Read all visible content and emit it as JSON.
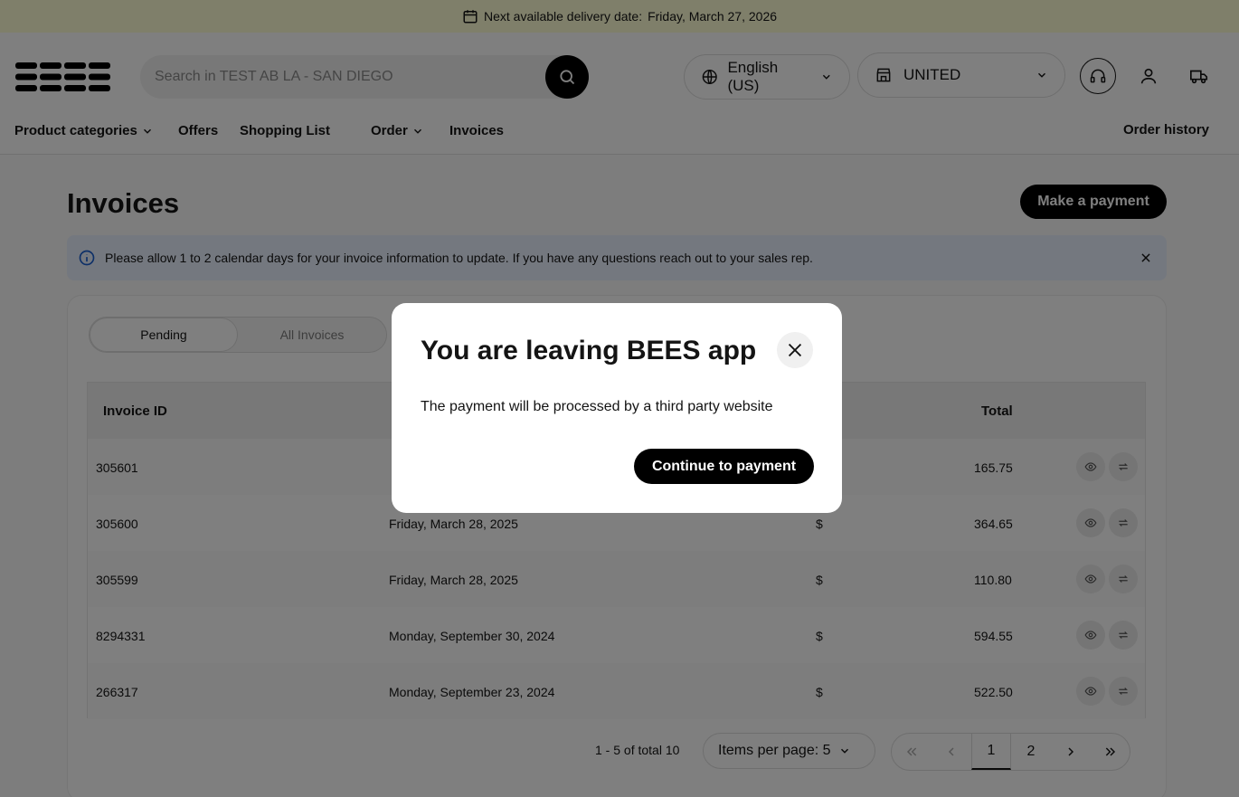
{
  "banner": {
    "prefix": "Next available delivery date:",
    "date": "Friday, March 27, 2026"
  },
  "header": {
    "search_placeholder": "Search in TEST AB LA - SAN DIEGO",
    "language": "English (US)",
    "store": "UNITED"
  },
  "nav": {
    "product_categories": "Product categories",
    "offers": "Offers",
    "shopping_list": "Shopping List",
    "order": "Order",
    "invoices": "Invoices",
    "order_history": "Order history"
  },
  "page": {
    "title": "Invoices",
    "make_payment": "Make a payment",
    "alert": "Please allow 1 to 2 calendar days for your invoice information to update. If you have any questions reach out to your sales rep."
  },
  "tabs": {
    "pending": "Pending",
    "all": "All Invoices"
  },
  "table": {
    "headers": {
      "invoice_id": "Invoice ID",
      "total": "Total"
    },
    "rows": [
      {
        "id": "305601",
        "date": "",
        "currency": "",
        "total": "165.75"
      },
      {
        "id": "305600",
        "date": "Friday, March 28, 2025",
        "currency": "$",
        "total": "364.65"
      },
      {
        "id": "305599",
        "date": "Friday, March 28, 2025",
        "currency": "$",
        "total": "110.80"
      },
      {
        "id": "8294331",
        "date": "Monday, September 30, 2024",
        "currency": "$",
        "total": "594.55"
      },
      {
        "id": "266317",
        "date": "Monday, September 23, 2024",
        "currency": "$",
        "total": "522.50"
      }
    ]
  },
  "pagination": {
    "count": "1 - 5 of total 10",
    "items_per_page": "Items per page: 5",
    "pages": [
      "1",
      "2"
    ]
  },
  "modal": {
    "title": "You are leaving BEES app",
    "body": "The payment will be processed by a third party website",
    "continue": "Continue to payment"
  }
}
